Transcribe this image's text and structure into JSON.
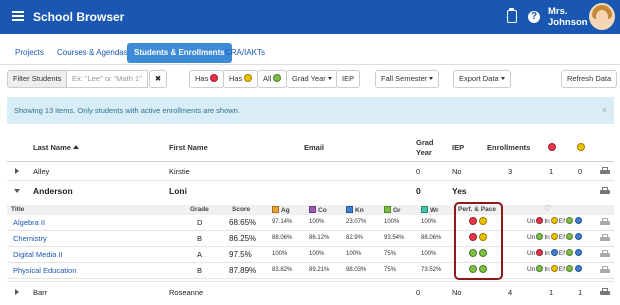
{
  "app": {
    "title": "School Browser",
    "user_line1": "Mrs.",
    "user_line2": "Johnson"
  },
  "icons": {
    "menu": "hamburger-icon",
    "clipboard": "clipboard-icon",
    "help": "help-icon",
    "avatar": "avatar"
  },
  "tabs": [
    {
      "label": "Projects",
      "active": false
    },
    {
      "label": "Courses & Agendas",
      "active": false
    },
    {
      "label": "Students & Enrollments",
      "active": true
    },
    {
      "label": "CRA/IAKTs",
      "active": false
    }
  ],
  "filters": {
    "filter_label": "Filter Students",
    "search_placeholder": "Ex: \"Lee\" or \"Math 1\"",
    "clear": "✖",
    "has": "Has",
    "all": "All",
    "grad_year": "Grad Year",
    "iep": "IEP",
    "semester": "Fall Semester",
    "export": "Export Data",
    "refresh": "Refresh Data"
  },
  "alert": {
    "text": "Showing 13 items. Only students with active enrollments are shown.",
    "close": "×"
  },
  "table": {
    "headers": {
      "last_name": "Last Name",
      "first_name": "First Name",
      "email": "Email",
      "grad_year_1": "Grad",
      "grad_year_2": "Year",
      "iep": "IEP",
      "enrollments": "Enrollments"
    },
    "rows": [
      {
        "last": "Alley",
        "first": "Kirstie",
        "grad": "0",
        "iep": "No",
        "enrollments": "3",
        "red": "1",
        "yellow": "0"
      },
      {
        "last": "Anderson",
        "first": "Loni",
        "grad": "0",
        "iep": "Yes"
      },
      {
        "last": "Barr",
        "first": "Roseanne",
        "grad": "0",
        "iep": "No",
        "enrollments": "4",
        "red": "1",
        "yellow": "1"
      }
    ]
  },
  "sub_table": {
    "headers": {
      "title": "Title",
      "grade": "Grade",
      "score": "Score",
      "ag": "Ag",
      "co": "Co",
      "kn": "Kn",
      "gr": "Gr",
      "wr": "Wr",
      "perf": "Perf. & Pace"
    },
    "category_colors": {
      "ag": "#f0a030",
      "co": "#9b59b6",
      "kn": "#3d7fd6",
      "gr": "#7bc043",
      "wr": "#3dc9a8"
    },
    "legend": {
      "un": "Un",
      "in": "In",
      "ef": "Ef"
    },
    "rows": [
      {
        "title": "Algebra II",
        "grade": "D",
        "score": "68.65%",
        "ag": "97.14%",
        "co": "100%",
        "kn": "23.07%",
        "gr": "100%",
        "wr": "100%",
        "perf": [
          "red",
          "yellow"
        ],
        "legend_dots": [
          "red",
          "yellow",
          "green",
          "blue"
        ]
      },
      {
        "title": "Chemistry",
        "grade": "B",
        "score": "86.25%",
        "ag": "88.06%",
        "co": "86.12%",
        "kn": "82.9%",
        "gr": "93.54%",
        "wr": "88.06%",
        "perf": [
          "red",
          "yellow"
        ],
        "legend_dots": [
          "green",
          "yellow",
          "green",
          "blue"
        ]
      },
      {
        "title": "Digital Media II",
        "grade": "A",
        "score": "97.5%",
        "ag": "100%",
        "co": "100%",
        "kn": "100%",
        "gr": "75%",
        "wr": "100%",
        "perf": [
          "green",
          "green"
        ],
        "legend_dots": [
          "red",
          "blue",
          "green",
          "blue"
        ]
      },
      {
        "title": "Physical Education",
        "grade": "B",
        "score": "87.89%",
        "ag": "83.82%",
        "co": "89.21%",
        "kn": "98.03%",
        "gr": "75%",
        "wr": "73.52%",
        "perf": [
          "green",
          "green"
        ],
        "legend_dots": [
          "green",
          "yellow",
          "green",
          "blue"
        ]
      }
    ]
  }
}
